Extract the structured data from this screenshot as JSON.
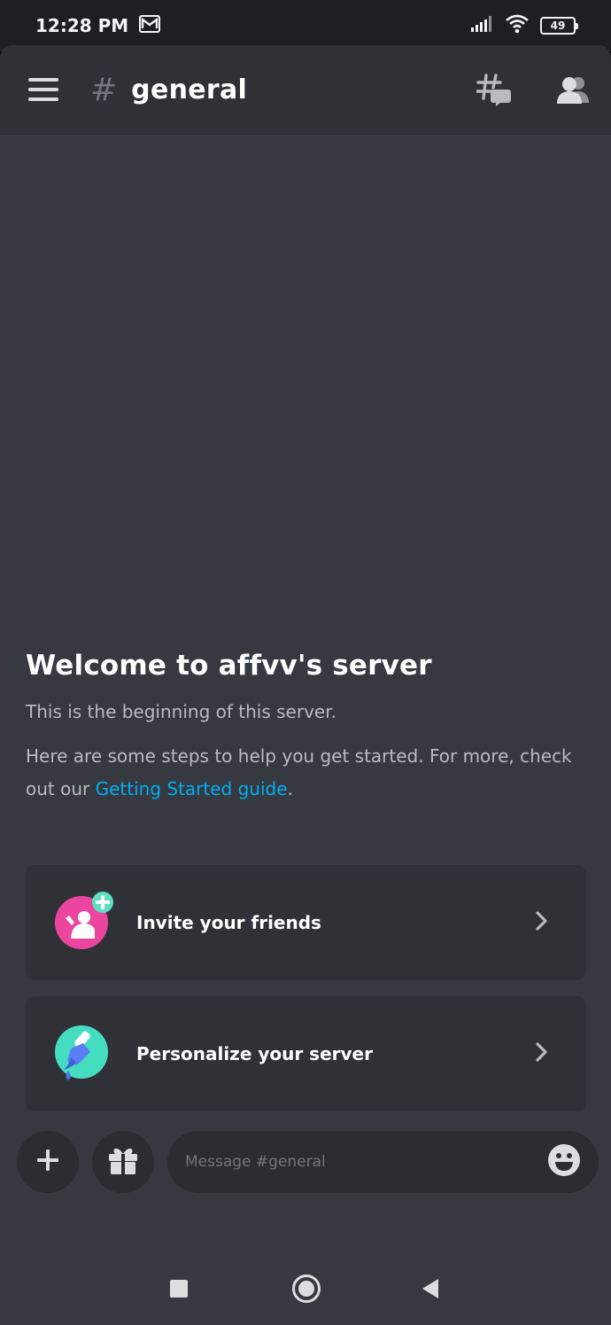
{
  "status_bar": {
    "time": "12:28 PM",
    "battery": "49"
  },
  "header": {
    "channel_hash": "#",
    "channel_name": "general"
  },
  "welcome": {
    "title": "Welcome to affvv's server",
    "line1": "This is the beginning of this server.",
    "line2_prefix": "Here are some steps to help you get started. For more, check out our ",
    "link_text": "Getting Started guide",
    "line2_suffix": "."
  },
  "cards": [
    {
      "label": "Invite your friends",
      "icon": "invite-friends-icon"
    },
    {
      "label": "Personalize your server",
      "icon": "personalize-icon"
    }
  ],
  "composer": {
    "placeholder": "Message #general"
  },
  "colors": {
    "background": "#36393f",
    "header": "#2f3136",
    "card": "#2f3136",
    "link": "#00aff4",
    "invite_pink": "#eb459f",
    "personalize_teal": "#45ddc0",
    "plus_green": "#5ce0c0"
  }
}
